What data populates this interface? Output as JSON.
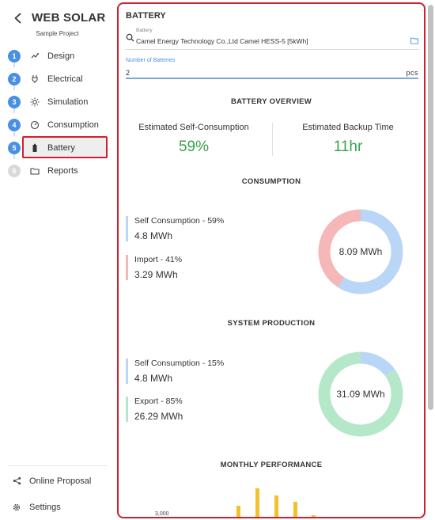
{
  "app": {
    "title": "WEB SOLAR",
    "project": "Sample Project"
  },
  "steps": [
    {
      "num": "1",
      "label": "Design",
      "icon": "design-icon",
      "active": false,
      "enabled": true
    },
    {
      "num": "2",
      "label": "Electrical",
      "icon": "plug-icon",
      "active": false,
      "enabled": true
    },
    {
      "num": "3",
      "label": "Simulation",
      "icon": "sun-icon",
      "active": false,
      "enabled": true
    },
    {
      "num": "4",
      "label": "Consumption",
      "icon": "gauge-icon",
      "active": false,
      "enabled": true
    },
    {
      "num": "5",
      "label": "Battery",
      "icon": "battery-icon",
      "active": true,
      "enabled": true
    },
    {
      "num": "6",
      "label": "Reports",
      "icon": "folder-icon",
      "active": false,
      "enabled": false
    }
  ],
  "bottom_links": [
    {
      "label": "Online Proposal",
      "icon": "share-icon"
    },
    {
      "label": "Settings",
      "icon": "gear-icon"
    }
  ],
  "battery": {
    "section_title": "BATTERY",
    "field_label": "Battery",
    "field_value": "Camel Energy Technology Co.,Ltd Camel HESS-5 [5kWh]",
    "count_label": "Number of Batteries",
    "count_value": "2",
    "count_unit": "pcs"
  },
  "overview": {
    "title": "BATTERY OVERVIEW",
    "self_consumption_label": "Estimated Self-Consumption",
    "self_consumption_value": "59%",
    "backup_label": "Estimated Backup Time",
    "backup_value": "11hr"
  },
  "consumption": {
    "title": "CONSUMPTION",
    "items": [
      {
        "label": "Self Consumption - 59%",
        "value": "4.8 MWh",
        "color": "#b9d6f7"
      },
      {
        "label": "Import - 41%",
        "value": "3.29 MWh",
        "color": "#f5b7b7"
      }
    ],
    "total": "8.09 MWh",
    "fractions": [
      0.59,
      0.41
    ]
  },
  "production": {
    "title": "SYSTEM PRODUCTION",
    "items": [
      {
        "label": "Self Consumption - 15%",
        "value": "4.8 MWh",
        "color": "#b9d6f7"
      },
      {
        "label": "Export - 85%",
        "value": "26.29 MWh",
        "color": "#b5e8c8"
      }
    ],
    "total": "31.09 MWh",
    "fractions": [
      0.15,
      0.85
    ]
  },
  "monthly": {
    "title": "MONTHLY PERFORMANCE",
    "axis_label": "3,000",
    "bar_color": "#f2c12e"
  },
  "colors": {
    "accent": "#4a90e2",
    "highlight_border": "#d0202e",
    "metric_green": "#3aa14f"
  }
}
